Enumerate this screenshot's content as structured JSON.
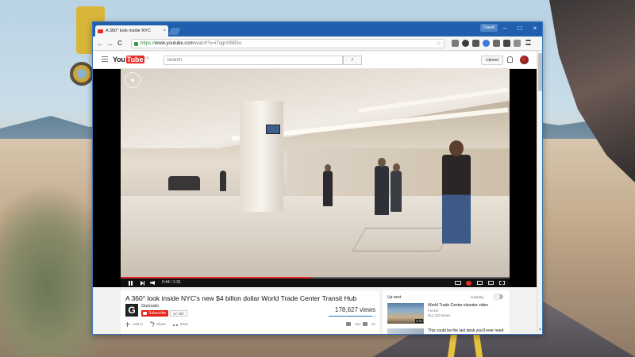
{
  "window": {
    "tab_title": "A 360° look inside NYC",
    "tab_close": "×",
    "user_name": "David",
    "min_glyph": "–",
    "max_glyph": "□",
    "close_glyph": "×"
  },
  "toolbar": {
    "back_glyph": "←",
    "forward_glyph": "→",
    "reload_glyph": "C",
    "url_scheme": "https://",
    "url_host": "www.youtube.com",
    "url_path": "/watch?v=i7ogrXt5B3o",
    "star_glyph": "☆"
  },
  "youtube": {
    "logo_you": "You",
    "logo_tube": "Tube",
    "logo_region": "CA",
    "search_placeholder": "Search",
    "search_glyph": "⌕",
    "upload_label": "Upload"
  },
  "player": {
    "time_current": "0:44",
    "time_total": "1:31",
    "time_display": "0:44 / 1:31",
    "progress_fraction": 0.49,
    "buffer_fraction": 0.49
  },
  "video": {
    "title": "A 360° look inside NYC's new $4 billon dollar World Trade Center Transit Hub",
    "channel_avatar_letter": "G",
    "channel_name": "Gizmodo",
    "subscribe_label": "Subscribe",
    "subscriber_count": "17,787",
    "view_count": "178,627 views",
    "likes_fraction": 0.92,
    "add_to_label": "Add to",
    "share_label": "Share",
    "more_label": "More",
    "like_count": "312",
    "dislike_count": "31"
  },
  "sidebar": {
    "up_next_label": "Up next",
    "autoplay_label": "Autoplay",
    "next_video": {
      "title": "World Trade Center elevator video",
      "channel": "Fuckin'",
      "views": "511,243 views",
      "duration": "0:34"
    },
    "second_video": {
      "title": "This could be the last desk you'll ever need"
    }
  },
  "colors": {
    "youtube_red": "#e52d27",
    "titlebar_blue": "#1f5fae",
    "link_green": "#2b8a3e"
  }
}
